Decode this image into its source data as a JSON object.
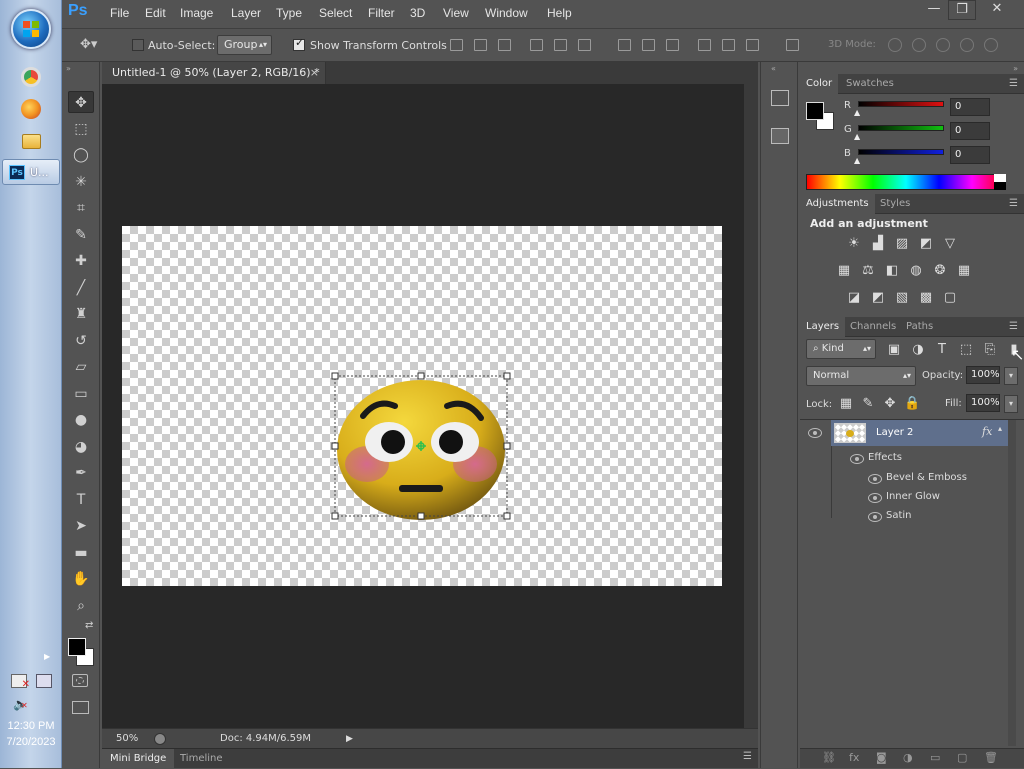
{
  "taskbar": {
    "start_label": "Start",
    "apps": [
      {
        "name": "chrome-icon",
        "color": "#e84a3b"
      },
      {
        "name": "firefox-icon",
        "color": "#f29422"
      },
      {
        "name": "file-explorer-icon",
        "color": "#f0c34a"
      }
    ],
    "active_task_badge": "Ps",
    "active_task_label": "U...",
    "clock_time": "12:30 PM",
    "clock_date": "7/20/2023"
  },
  "app": {
    "logo": "Ps",
    "menu": [
      "File",
      "Edit",
      "Image",
      "Layer",
      "Type",
      "Select",
      "Filter",
      "3D",
      "View",
      "Window",
      "Help"
    ],
    "window_buttons": {
      "minimize": "—",
      "restore": "❐",
      "close": "✕"
    }
  },
  "options_bar": {
    "auto_select_label": "Auto-Select:",
    "auto_select_checked": false,
    "group_value": "Group",
    "show_transform_label": "Show Transform Controls",
    "show_transform_checked": true,
    "mode_3d_label": "3D Mode:"
  },
  "document": {
    "tab_title": "Untitled-1 @ 50% (Layer 2, RGB/16) *",
    "close": "×",
    "zoom": "50%",
    "doc_size": "Doc: 4.94M/6.59M",
    "bottom_tabs": [
      "Mini Bridge",
      "Timeline"
    ]
  },
  "color_panel": {
    "tabs": [
      "Color",
      "Swatches"
    ],
    "channels": [
      {
        "label": "R",
        "value": "0",
        "color": "#e01010"
      },
      {
        "label": "G",
        "value": "0",
        "color": "#10c010"
      },
      {
        "label": "B",
        "value": "0",
        "color": "#1020e0"
      }
    ]
  },
  "adjustments_panel": {
    "tabs": [
      "Adjustments",
      "Styles"
    ],
    "heading": "Add an adjustment"
  },
  "layers_panel": {
    "tabs": [
      "Layers",
      "Channels",
      "Paths"
    ],
    "filter_kind": "Kind",
    "blend_mode": "Normal",
    "opacity_label": "Opacity:",
    "opacity": "100%",
    "lock_label": "Lock:",
    "fill_label": "Fill:",
    "fill": "100%",
    "layer_name": "Layer 2",
    "fx": "fx",
    "effects_label": "Effects",
    "effects": [
      "Bevel & Emboss",
      "Inner Glow",
      "Satin"
    ]
  }
}
